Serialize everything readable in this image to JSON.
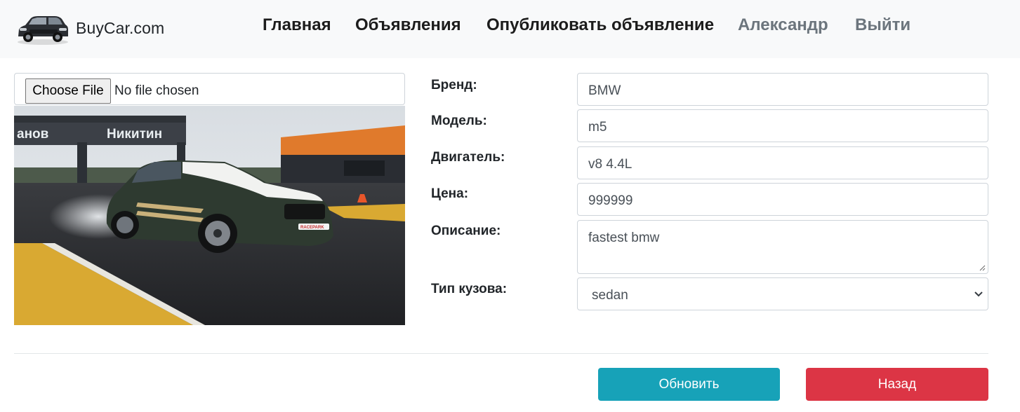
{
  "navbar": {
    "brand_text": "BuyCar.com",
    "links": [
      {
        "label": "Главная"
      },
      {
        "label": "Объявления"
      },
      {
        "label": "Опубликовать объявление"
      }
    ],
    "user_name": "Александр",
    "logout_label": "Выйти"
  },
  "upload": {
    "button_label": "Choose File",
    "status_text": "No file chosen"
  },
  "photo": {
    "banner_words": [
      "анов",
      "Никитин"
    ],
    "plate_text": "RACEPARK"
  },
  "form": {
    "brand_label": "Бренд:",
    "brand_value": "BMW",
    "model_label": "Модель:",
    "model_value": "m5",
    "engine_label": "Двигатель:",
    "engine_value": "v8 4.4L",
    "price_label": "Цена:",
    "price_value": "999999",
    "description_label": "Описание:",
    "description_value": "fastest bmw",
    "body_type_label": "Тип кузова:",
    "body_type_value": "sedan"
  },
  "actions": {
    "update_label": "Обновить",
    "back_label": "Назад"
  },
  "colors": {
    "update_button": "#17a2b8",
    "back_button": "#dc3545",
    "navbar_bg": "#f8f9fa"
  }
}
